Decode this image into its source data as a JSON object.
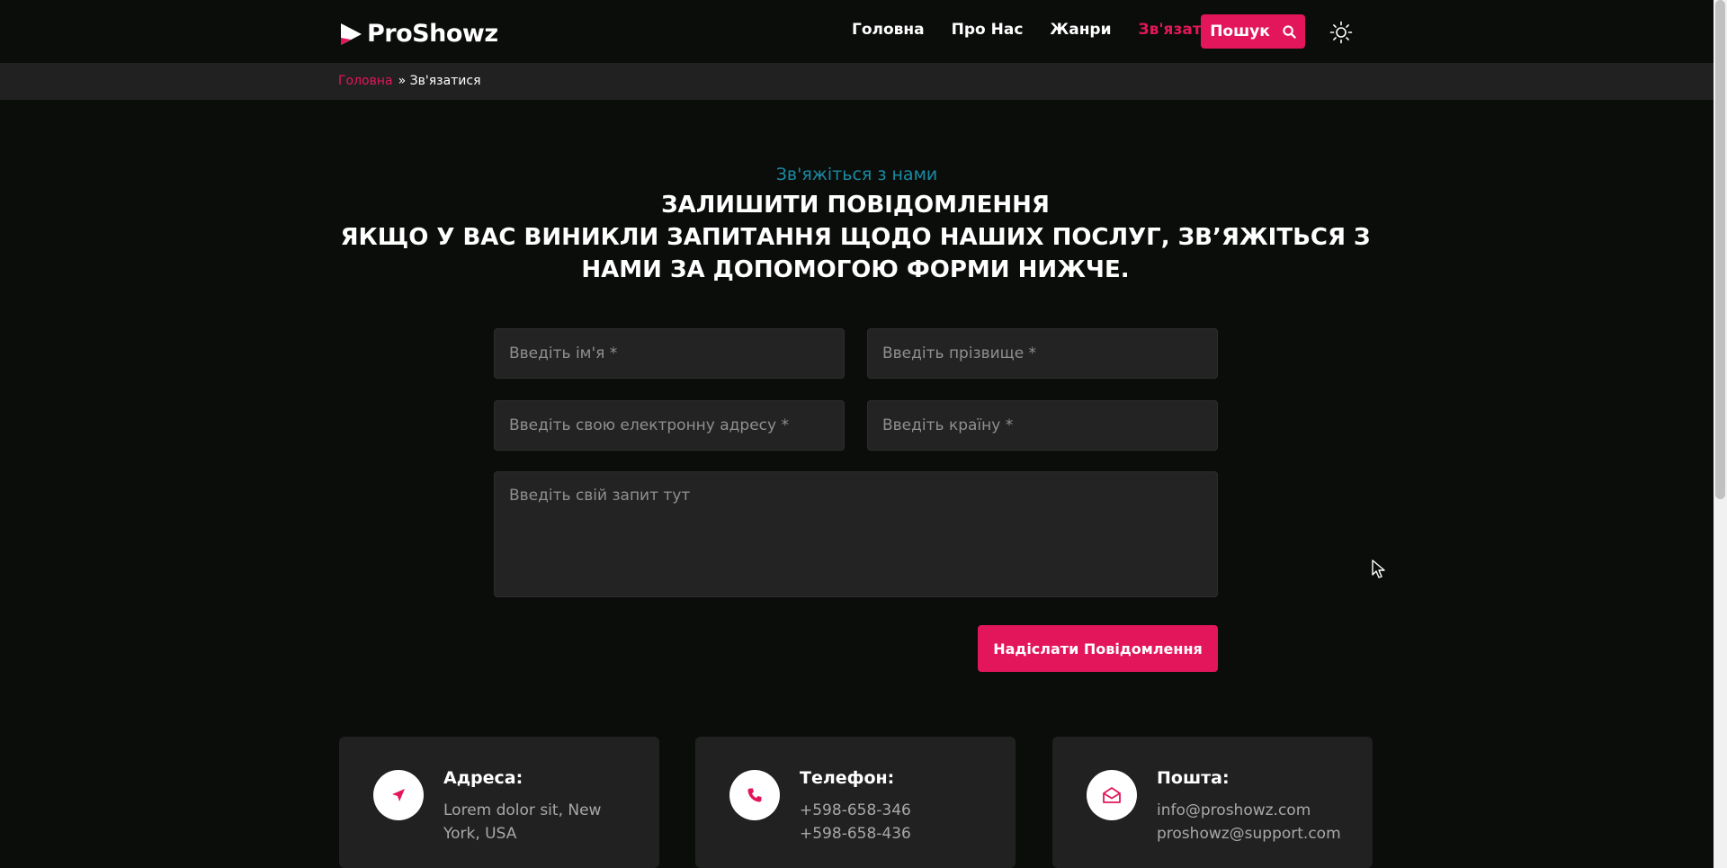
{
  "header": {
    "logo_text": "ProShowz",
    "nav": [
      {
        "label": "Головна"
      },
      {
        "label": "Про Нас"
      },
      {
        "label": "Жанри"
      },
      {
        "label": "Зв'язатися"
      }
    ],
    "active_nav": "Зв'язатися",
    "search_label": "Пошук"
  },
  "breadcrumb": {
    "home": "Головна",
    "current": "» Зв'язатися"
  },
  "contact": {
    "subtitle": "Зв'яжіться з нами",
    "title_line1": "ЗАЛИШИТИ ПОВІДОМЛЕННЯ",
    "title_line2": "ЯКЩО У ВАС ВИНИКЛИ ЗАПИТАННЯ ЩОДО НАШИХ ПОСЛУГ, ЗВ’ЯЖІТЬСЯ З НАМИ ЗА ДОПОМОГОЮ ФОРМИ НИЖЧЕ."
  },
  "form": {
    "first_name_placeholder": "Введіть ім'я *",
    "last_name_placeholder": "Введіть прізвище *",
    "email_placeholder": "Введіть свою електронну адресу *",
    "country_placeholder": "Введіть країну *",
    "message_placeholder": "Введіть свій запит тут",
    "submit_label": "Надіслати Повідомлення"
  },
  "cards": [
    {
      "title": "Адреса:",
      "lines": [
        "Lorem dolor sit, New York, USA"
      ],
      "icon": "location-arrow-icon"
    },
    {
      "title": "Телефон:",
      "lines": [
        "+598-658-346",
        "+598-658-436"
      ],
      "icon": "phone-icon"
    },
    {
      "title": "Пошта:",
      "lines": [
        "info@proshowz.com",
        "proshowz@support.com"
      ],
      "icon": "envelope-open-icon"
    }
  ],
  "colors": {
    "accent": "#e3165b",
    "background": "#0b0d0b",
    "surface": "#212121",
    "subtitle": "#1b8aa3"
  }
}
